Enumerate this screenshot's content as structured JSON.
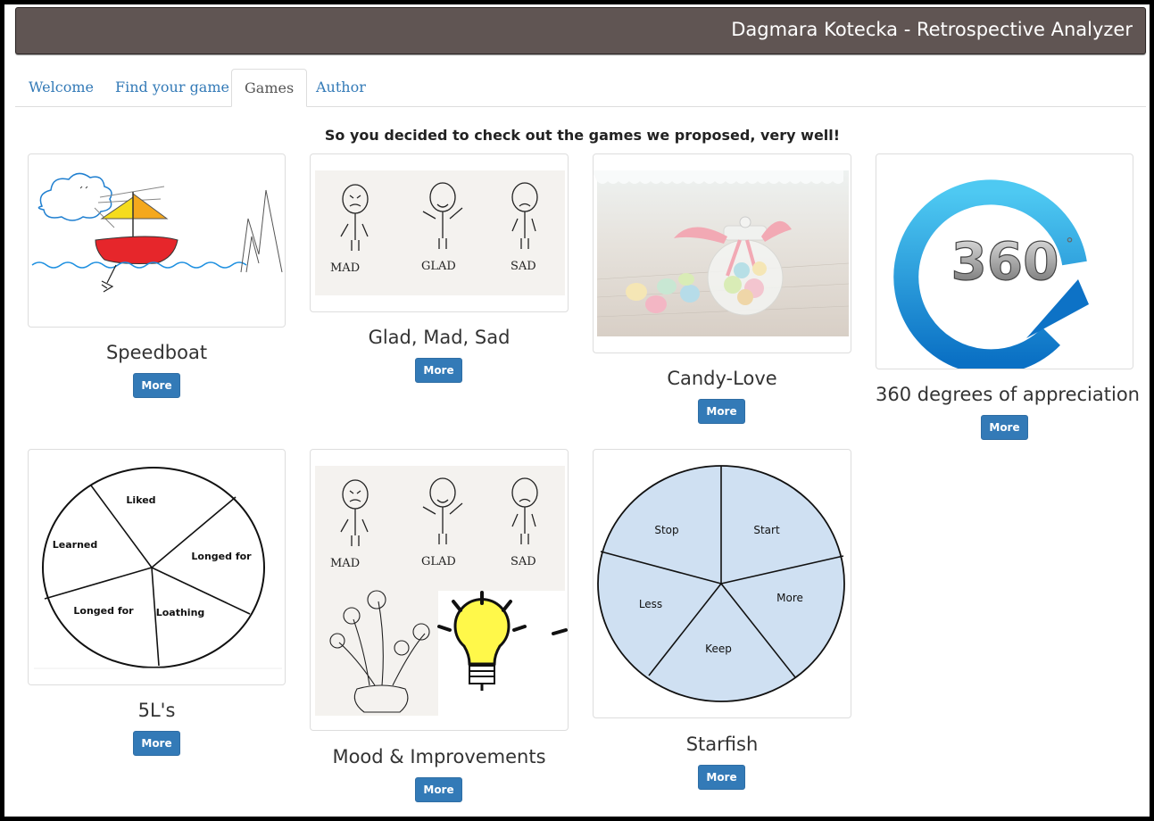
{
  "header": {
    "title": "Dagmara Kotecka - Retrospective Analyzer"
  },
  "tabs": [
    {
      "label": "Welcome",
      "active": false
    },
    {
      "label": "Find your game",
      "active": false
    },
    {
      "label": "Games",
      "active": true
    },
    {
      "label": "Author",
      "active": false
    }
  ],
  "intro": "So you decided to check out the games we proposed, very well!",
  "more_label": "More",
  "games": [
    {
      "name": "Speedboat",
      "image": "speedboat-drawing"
    },
    {
      "name": "Glad, Mad, Sad",
      "image": "stick-figures-faces",
      "image_text": [
        "MAD",
        "GLAD",
        "SAD"
      ]
    },
    {
      "name": "Candy-Love",
      "image": "candy-jar-photo"
    },
    {
      "name": "360 degrees of appreciation",
      "image": "360-arrow-logo",
      "image_text": [
        "360",
        "°"
      ]
    },
    {
      "name": "5L's",
      "image": "5l-pie-diagram",
      "image_text": [
        "Liked",
        "Learned",
        "Longed for",
        "Longed for",
        "Loathing"
      ]
    },
    {
      "name": "Mood & Improvements",
      "image": "faces-flowers-lightbulb",
      "image_text": [
        "MAD",
        "GLAD",
        "SAD"
      ]
    },
    {
      "name": "Starfish",
      "image": "starfish-circle-diagram",
      "image_text": [
        "Stop",
        "Start",
        "Less",
        "More",
        "Keep"
      ]
    }
  ],
  "colors": {
    "header_bg": "#605553",
    "link": "#337ab7",
    "button": "#337ab7",
    "starfish_fill": "#cfe0f2",
    "sail_yellow": "#f5dc1e",
    "sail_orange": "#f4a81d",
    "boat_red": "#e6262b",
    "water_blue": "#1e90e0"
  }
}
